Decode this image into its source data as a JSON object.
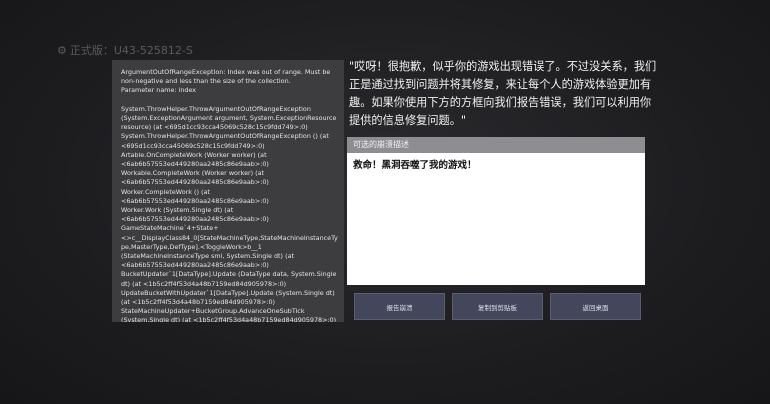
{
  "version": {
    "icon": "gear-icon",
    "label": "正式版：U43-525812-S"
  },
  "error": {
    "stack_trace": "ArgumentOutOfRangeException: Index was out of range. Must be non-negative and less than the size of the collection.\nParameter name: index\n\nSystem.ThrowHelper.ThrowArgumentOutOfRangeException (System.ExceptionArgument argument, System.ExceptionResource resource) (at <695d1cc93cca45069c528c15c9fdd749>:0)\nSystem.ThrowHelper.ThrowArgumentOutOfRangeException () (at <695d1cc93cca45069c528c15c9fdd749>:0)\nArtable.OnCompleteWork (Worker worker) (at <6ab6b57553ed449280aa2485c86e9aab>:0)\nWorkable.CompleteWork (Worker worker) (at <6ab6b57553ed449280aa2485c86e9aab>:0)\nWorker.CompleteWork () (at <6ab6b57553ed449280aa2485c86e9aab>:0)\nWorker.Work (System.Single dt) (at <6ab6b57553ed449280aa2485c86e9aab>:0)\nGameStateMachine`4+State+<>c__DisplayClass84_0[StateMachineType,StateMachineInstanceType,MasterType,DefType].<ToggleWork>b__1 (StateMachineInstanceType smi, System.Single dt) (at <6ab6b57553ed449280aa2485c86e9aab>:0)\nBucketUpdater`1[DataType].Update (DataType data, System.Single dt) (at <1b5c2ff4f53d4a48b7159ed84d905978>:0)\nUpdateBucketWithUpdater`1[DataType].Update (System.Single dt) (at <1b5c2ff4f53d4a48b7159ed84d905978>:0)\nStateMachineUpdater+BucketGroup.AdvanceOneSubTick (System.Single dt) (at <1b5c2ff4f53d4a48b7159ed84d905978>:0)"
  },
  "message": "\"哎呀！很抱歉，似乎你的游戏出现错误了。不过没关系，我们正是通过找到问题并将其修复，来让每个人的游戏体验更加有趣。如果你使用下方的方框向我们报告错误，我们可以利用你提供的信息修复问题。\"",
  "crash_description": {
    "header": "可选的崩溃描述",
    "value": "救命！黑洞吞噬了我的游戏！"
  },
  "buttons": {
    "report": "报告崩溃",
    "copy": "复制到剪贴板",
    "desktop": "返回桌面"
  }
}
